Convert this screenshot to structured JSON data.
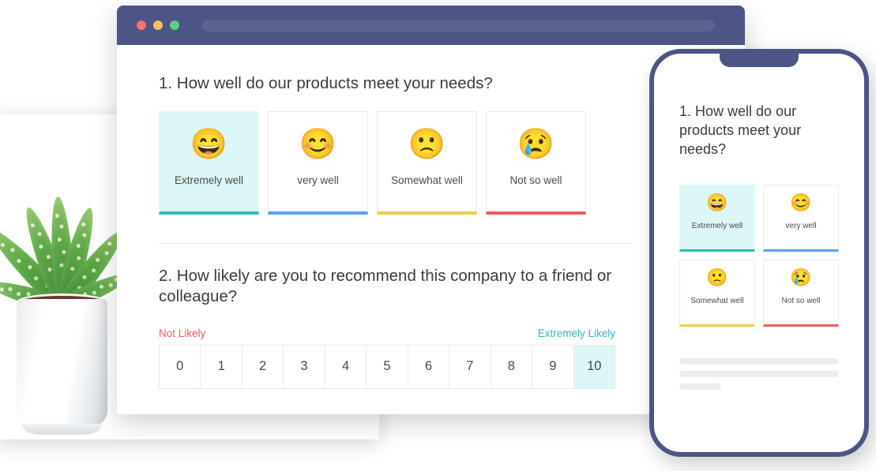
{
  "browser": {
    "window_controls": [
      "close",
      "minimize",
      "maximize"
    ],
    "address_bar_value": ""
  },
  "survey": {
    "question1": {
      "text": "1. How well do our products meet your needs?",
      "options": [
        {
          "emoji": "😄",
          "emoji_name": "grinning-face-with-smiling-eyes",
          "label": "Extremely well",
          "accent": "#2fbfb2",
          "selected": true
        },
        {
          "emoji": "😊",
          "emoji_name": "smiling-face-with-smiling-eyes",
          "label": "very well",
          "accent": "#5a9ef2",
          "selected": false
        },
        {
          "emoji": "🙁",
          "emoji_name": "slightly-frowning-face",
          "label": "Somewhat well",
          "accent": "#f0cf4a",
          "selected": false
        },
        {
          "emoji": "😢",
          "emoji_name": "crying-face",
          "label": "Not so well",
          "accent": "#ef5b5b",
          "selected": false
        }
      ]
    },
    "question2": {
      "text": "2. How likely are you to recommend this company to a friend or colleague?",
      "low_label": "Not Likely",
      "high_label": "Extremely Likely",
      "scale": [
        "0",
        "1",
        "2",
        "3",
        "4",
        "5",
        "6",
        "7",
        "8",
        "9",
        "10"
      ],
      "selected_value": "10"
    }
  },
  "phone": {
    "question_text": "1. How well do our products meet your needs?",
    "options": [
      {
        "emoji": "😄",
        "emoji_name": "grinning-face-with-smiling-eyes",
        "label": "Extremely well",
        "accent": "#2fbfb2",
        "selected": true
      },
      {
        "emoji": "😊",
        "emoji_name": "smiling-face-with-smiling-eyes",
        "label": "very well",
        "accent": "#5a9ef2",
        "selected": false
      },
      {
        "emoji": "🙁",
        "emoji_name": "slightly-frowning-face",
        "label": "Somewhat well",
        "accent": "#f0cf4a",
        "selected": false
      },
      {
        "emoji": "😢",
        "emoji_name": "crying-face",
        "label": "Not so well",
        "accent": "#ef5b5b",
        "selected": false
      }
    ],
    "placeholder_bars": [
      100,
      100,
      26
    ]
  },
  "decoration": {
    "photo_alt": "potted-aloe-plant"
  },
  "colors": {
    "chrome_navy": "#4c5585",
    "selected_bg": "#dcf7f5",
    "teal": "#2cb9bd",
    "red": "#ef5b5b",
    "text": "#3c3c3c"
  }
}
